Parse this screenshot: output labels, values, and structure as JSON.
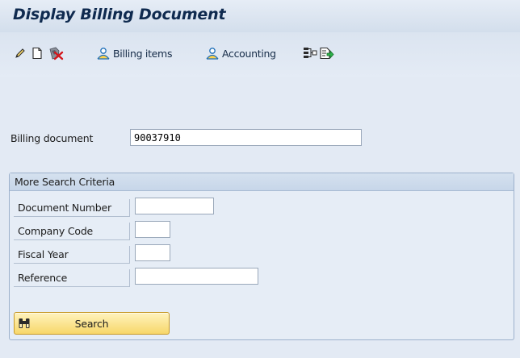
{
  "window": {
    "title": "Display Billing Document"
  },
  "toolbar": {
    "items": [
      {
        "icon": "pencil-icon"
      },
      {
        "icon": "new-document-icon"
      },
      {
        "icon": "cancel-document-icon"
      },
      {
        "icon": "person-icon",
        "label": "Billing items"
      },
      {
        "icon": "person-icon",
        "label": "Accounting"
      },
      {
        "icon": "structure-icon"
      },
      {
        "icon": "output-icon"
      }
    ]
  },
  "main": {
    "billing_document_label": "Billing document",
    "billing_document_value": "90037910"
  },
  "search_group": {
    "title": "More Search Criteria",
    "fields": [
      {
        "label": "Document Number",
        "value": ""
      },
      {
        "label": "Company Code",
        "value": ""
      },
      {
        "label": "Fiscal Year",
        "value": ""
      },
      {
        "label": "Reference",
        "value": ""
      }
    ],
    "search_button_label": "Search"
  },
  "colors": {
    "title": "#0f2a4f",
    "background": "#e3eaf4",
    "button": "#f7d76a",
    "group_header": "#c7d6e9"
  }
}
